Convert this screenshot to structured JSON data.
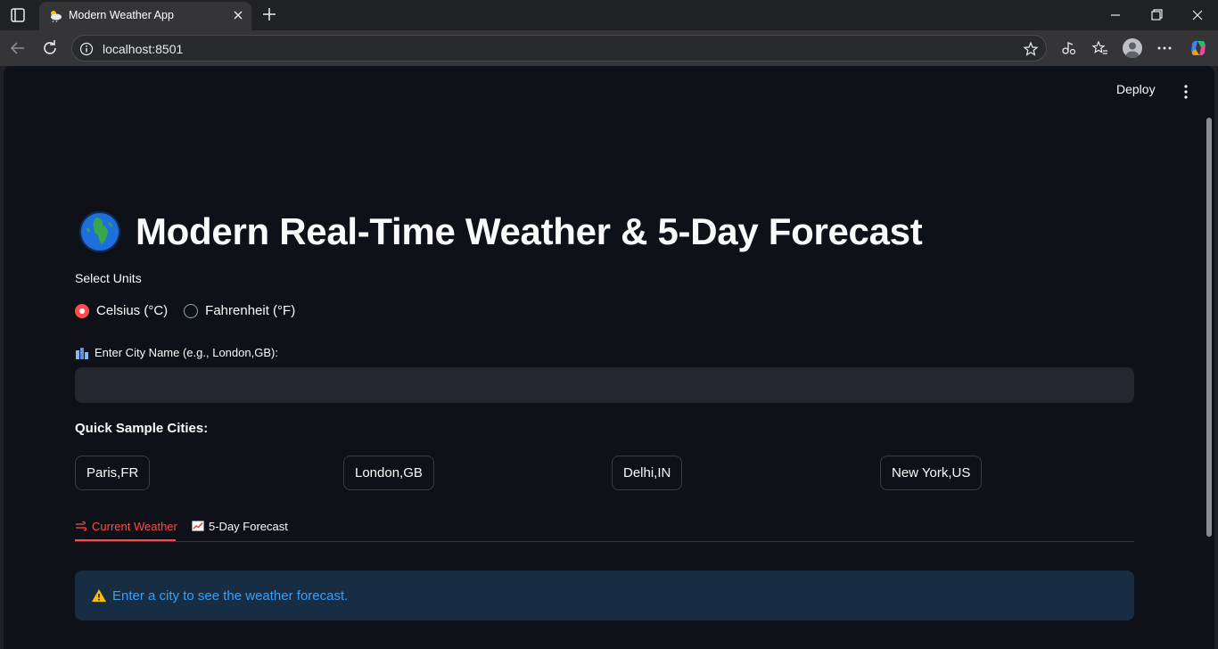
{
  "browser": {
    "tab_title": "Modern Weather App",
    "url": "localhost:8501"
  },
  "app": {
    "deploy_label": "Deploy",
    "title": "Modern Real-Time Weather & 5-Day Forecast",
    "units": {
      "label": "Select Units",
      "options": [
        "Celsius (°C)",
        "Fahrenheit (°F)"
      ],
      "selected": "Celsius (°C)"
    },
    "city": {
      "label": "Enter City Name (e.g., London,GB):",
      "value": ""
    },
    "quick": {
      "title": "Quick Sample Cities:",
      "cities": [
        "Paris,FR",
        "London,GB",
        "Delhi,IN",
        "New York,US"
      ]
    },
    "tabs": [
      "Current Weather",
      "5-Day Forecast"
    ],
    "active_tab": "Current Weather",
    "alert": "Enter a city to see the weather forecast."
  },
  "colors": {
    "accent": "#ff4b4b",
    "background": "#0e1117",
    "info_bg": "#172d43",
    "info_text": "#3d9df3"
  }
}
